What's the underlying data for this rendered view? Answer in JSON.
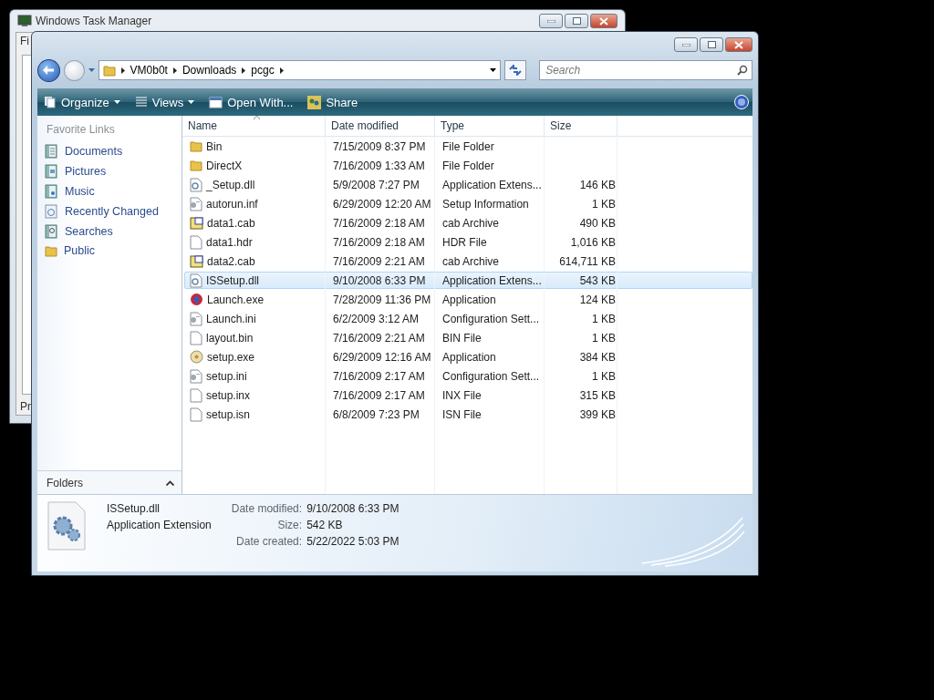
{
  "task_manager": {
    "title": "Windows Task Manager",
    "menu_partial": "Fi",
    "status_partial": "Pr"
  },
  "explorer": {
    "breadcrumb": [
      "VM0b0t",
      "Downloads",
      "pcgc"
    ],
    "search": {
      "placeholder": "Search"
    },
    "toolbar": [
      {
        "label": "Organize",
        "kind": "organize",
        "dropdown": true
      },
      {
        "label": "Views",
        "kind": "views",
        "dropdown": true
      },
      {
        "label": "Open With...",
        "kind": "open",
        "dropdown": false
      },
      {
        "label": "Share",
        "kind": "share",
        "dropdown": false
      }
    ],
    "nav": {
      "header": "Favorite Links",
      "folders_label": "Folders",
      "items": [
        {
          "label": "Documents",
          "kind": "documents"
        },
        {
          "label": "Pictures",
          "kind": "pictures"
        },
        {
          "label": "Music",
          "kind": "music"
        },
        {
          "label": "Recently Changed",
          "kind": "recent"
        },
        {
          "label": "Searches",
          "kind": "searches"
        },
        {
          "label": "Public",
          "kind": "folder"
        }
      ]
    },
    "columns": [
      {
        "label": "Name",
        "sorted": true
      },
      {
        "label": "Date modified",
        "sorted": false
      },
      {
        "label": "Type",
        "sorted": false
      },
      {
        "label": "Size",
        "sorted": false
      }
    ],
    "rows": [
      {
        "kind": "folder",
        "name": "Bin",
        "date": "7/15/2009 8:37 PM",
        "type": "File Folder",
        "selected": false
      },
      {
        "kind": "folder",
        "name": "DirectX",
        "date": "7/16/2009 1:33 AM",
        "type": "File Folder",
        "selected": false
      },
      {
        "kind": "dll",
        "name": "_Setup.dll",
        "date": "5/9/2008 7:27 PM",
        "type": "Application Extens...",
        "size": "146 KB",
        "selected": false
      },
      {
        "kind": "config",
        "name": "autorun.inf",
        "date": "6/29/2009 12:20 AM",
        "type": "Setup Information",
        "size": "1 KB",
        "selected": false
      },
      {
        "kind": "cab",
        "name": "data1.cab",
        "date": "7/16/2009 2:18 AM",
        "type": "cab Archive",
        "size": "490 KB",
        "selected": false
      },
      {
        "kind": "blank",
        "name": "data1.hdr",
        "date": "7/16/2009 2:18 AM",
        "type": "HDR File",
        "size": "1,016 KB",
        "selected": false
      },
      {
        "kind": "cab",
        "name": "data2.cab",
        "date": "7/16/2009 2:21 AM",
        "type": "cab Archive",
        "size": "614,711 KB",
        "selected": false
      },
      {
        "kind": "dll",
        "name": "ISSetup.dll",
        "date": "9/10/2008 6:33 PM",
        "type": "Application Extens...",
        "size": "543 KB",
        "selected": true
      },
      {
        "kind": "orb",
        "name": "Launch.exe",
        "date": "7/28/2009 11:36 PM",
        "type": "Application",
        "size": "124 KB",
        "selected": false
      },
      {
        "kind": "config",
        "name": "Launch.ini",
        "date": "6/2/2009 3:12 AM",
        "type": "Configuration Sett...",
        "size": "1 KB",
        "selected": false
      },
      {
        "kind": "blank",
        "name": "layout.bin",
        "date": "7/16/2009 2:21 AM",
        "type": "BIN File",
        "size": "1 KB",
        "selected": false
      },
      {
        "kind": "disc",
        "name": "setup.exe",
        "date": "6/29/2009 12:16 AM",
        "type": "Application",
        "size": "384 KB",
        "selected": false
      },
      {
        "kind": "config",
        "name": "setup.ini",
        "date": "7/16/2009 2:17 AM",
        "type": "Configuration Sett...",
        "size": "1 KB",
        "selected": false
      },
      {
        "kind": "blank",
        "name": "setup.inx",
        "date": "7/16/2009 2:17 AM",
        "type": "INX File",
        "size": "315 KB",
        "selected": false
      },
      {
        "kind": "blank",
        "name": "setup.isn",
        "date": "6/8/2009 7:23 PM",
        "type": "ISN File",
        "size": "399 KB",
        "selected": false
      }
    ],
    "details": {
      "name": "ISSetup.dll",
      "type": "Application Extension",
      "fields": [
        {
          "label": "Date modified:",
          "value": "9/10/2008 6:33 PM"
        },
        {
          "label": "Size:",
          "value": "542 KB"
        },
        {
          "label": "Date created:",
          "value": "5/22/2022 5:03 PM"
        }
      ]
    }
  }
}
